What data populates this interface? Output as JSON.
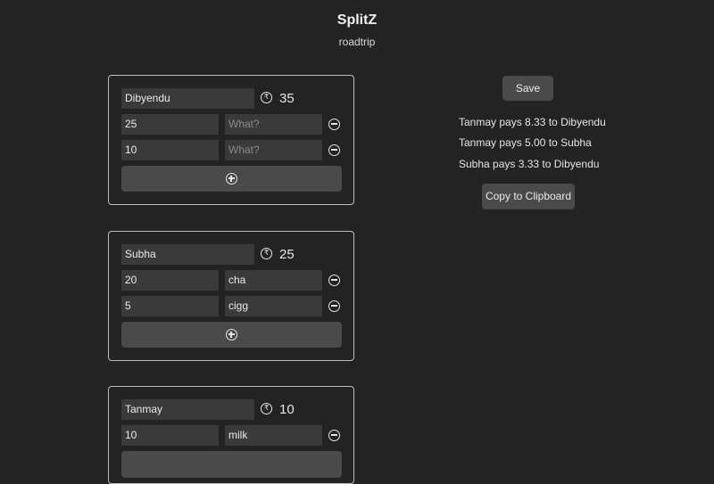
{
  "app": {
    "title": "SplitZ",
    "subtitle": "roadtrip"
  },
  "currency_icon": "rupee-icon",
  "people": [
    {
      "name": "Dibyendu",
      "total": "35",
      "expenses": [
        {
          "amount": "25",
          "desc": "",
          "desc_placeholder": "What?"
        },
        {
          "amount": "10",
          "desc": "",
          "desc_placeholder": "What?"
        }
      ]
    },
    {
      "name": "Subha",
      "total": "25",
      "expenses": [
        {
          "amount": "20",
          "desc": "cha",
          "desc_placeholder": "What?"
        },
        {
          "amount": "5",
          "desc": "cigg",
          "desc_placeholder": "What?"
        }
      ]
    },
    {
      "name": "Tanmay",
      "total": "10",
      "expenses": [
        {
          "amount": "10",
          "desc": "milk",
          "desc_placeholder": "What?"
        }
      ]
    }
  ],
  "actions": {
    "save_label": "Save",
    "copy_label": "Copy to Clipboard"
  },
  "settlements": [
    "Tanmay pays 8.33 to Dibyendu",
    "Tanmay pays 5.00 to Subha",
    "Subha pays 3.33 to Dibyendu"
  ],
  "colors": {
    "background": "#232323",
    "input": "#3a3a3a",
    "button": "#4a4a4a",
    "border": "#bdbdbd"
  }
}
